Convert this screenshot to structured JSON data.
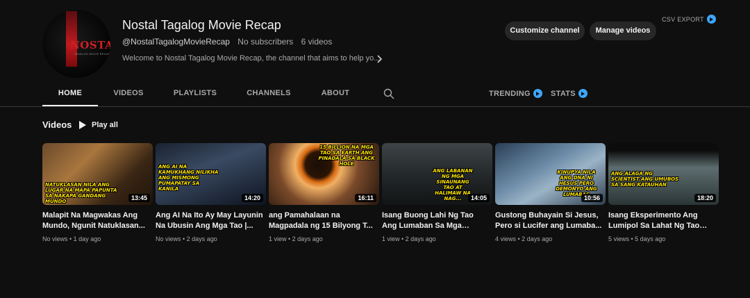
{
  "channel": {
    "name": "Nostal Tagalog Movie Recap",
    "handle": "@NostalTagalogMovieRecap",
    "subscribers": "No subscribers",
    "video_count": "6 videos",
    "description": "Welcome to Nostal Tagalog Movie Recap, the channel that aims to help yo...",
    "avatar_logo_text": "NOSTAL",
    "avatar_logo_subtext": "TAGALOG MOVIE RECAP"
  },
  "buttons": {
    "customize": "Customize channel",
    "manage": "Manage videos"
  },
  "csv_export": "CSV EXPORT",
  "tabs": [
    {
      "label": "HOME",
      "active": true
    },
    {
      "label": "VIDEOS",
      "active": false
    },
    {
      "label": "PLAYLISTS",
      "active": false
    },
    {
      "label": "CHANNELS",
      "active": false
    },
    {
      "label": "ABOUT",
      "active": false
    }
  ],
  "side_links": {
    "trending": "TRENDING",
    "stats": "STATS"
  },
  "section": {
    "title": "Videos",
    "play_all": "Play all"
  },
  "videos": [
    {
      "title": "Malapit Na Magwakas Ang Mundo, Ngunit Natuklasan...",
      "duration": "13:45",
      "views": "No views",
      "age": "1 day ago",
      "caption": "NATUKLASAN NILA ANG LUGAR NA MAPA PAPUNTA SA NAKAPA GANDANG MUNDO"
    },
    {
      "title": "Ang AI Na Ito Ay May Layunin Na Ubusin Ang Mga Tao |...",
      "duration": "14:20",
      "views": "No views",
      "age": "2 days ago",
      "caption": "ANG AI NA KAMUKHANG NILIKHA ANG MISMONG PUMAPATAY SA KANILA"
    },
    {
      "title": "ang Pamahalaan na Magpadala ng 15 Bilyong T...",
      "duration": "16:11",
      "views": "1 view",
      "age": "2 days ago",
      "caption": "15 BILLION NA MGA TAO SA EARTH ANG PINADALA SA BLACK HOLE"
    },
    {
      "title": "Isang Buong Lahi Ng Tao Ang Lumaban Sa Mga Halimaw...",
      "duration": "14:05",
      "views": "1 view",
      "age": "2 days ago",
      "caption": "ANG LABANAN NG MGA SINAUNANG TAO AT HALIMAW NA NAG..."
    },
    {
      "title": "Gustong Buhayain Si Jesus, Pero si Lucifer ang Lumaba...",
      "duration": "10:56",
      "views": "4 views",
      "age": "2 days ago",
      "caption": "KINUPYA NILA ANG DNA NI HESUS PERO DEMONYO ANG LUMABAS"
    },
    {
      "title": "Isang Eksperimento Ang Lumipol Sa Lahat Ng Tao Sa...",
      "duration": "18:20",
      "views": "5 views",
      "age": "5 days ago",
      "caption": "ANG ALAGA NG SCIENTIST ANG UMUBOS SA SANG KATAUHAN"
    }
  ],
  "colors": {
    "background": "#0f0f0f",
    "button_bg": "#272727",
    "accent_blue": "#3ea6ff",
    "caption_yellow": "#ffe600"
  },
  "icons": {
    "search": "search-icon",
    "chevron": "chevron-right-icon",
    "play": "play-icon",
    "extension": "extension-play-icon"
  }
}
